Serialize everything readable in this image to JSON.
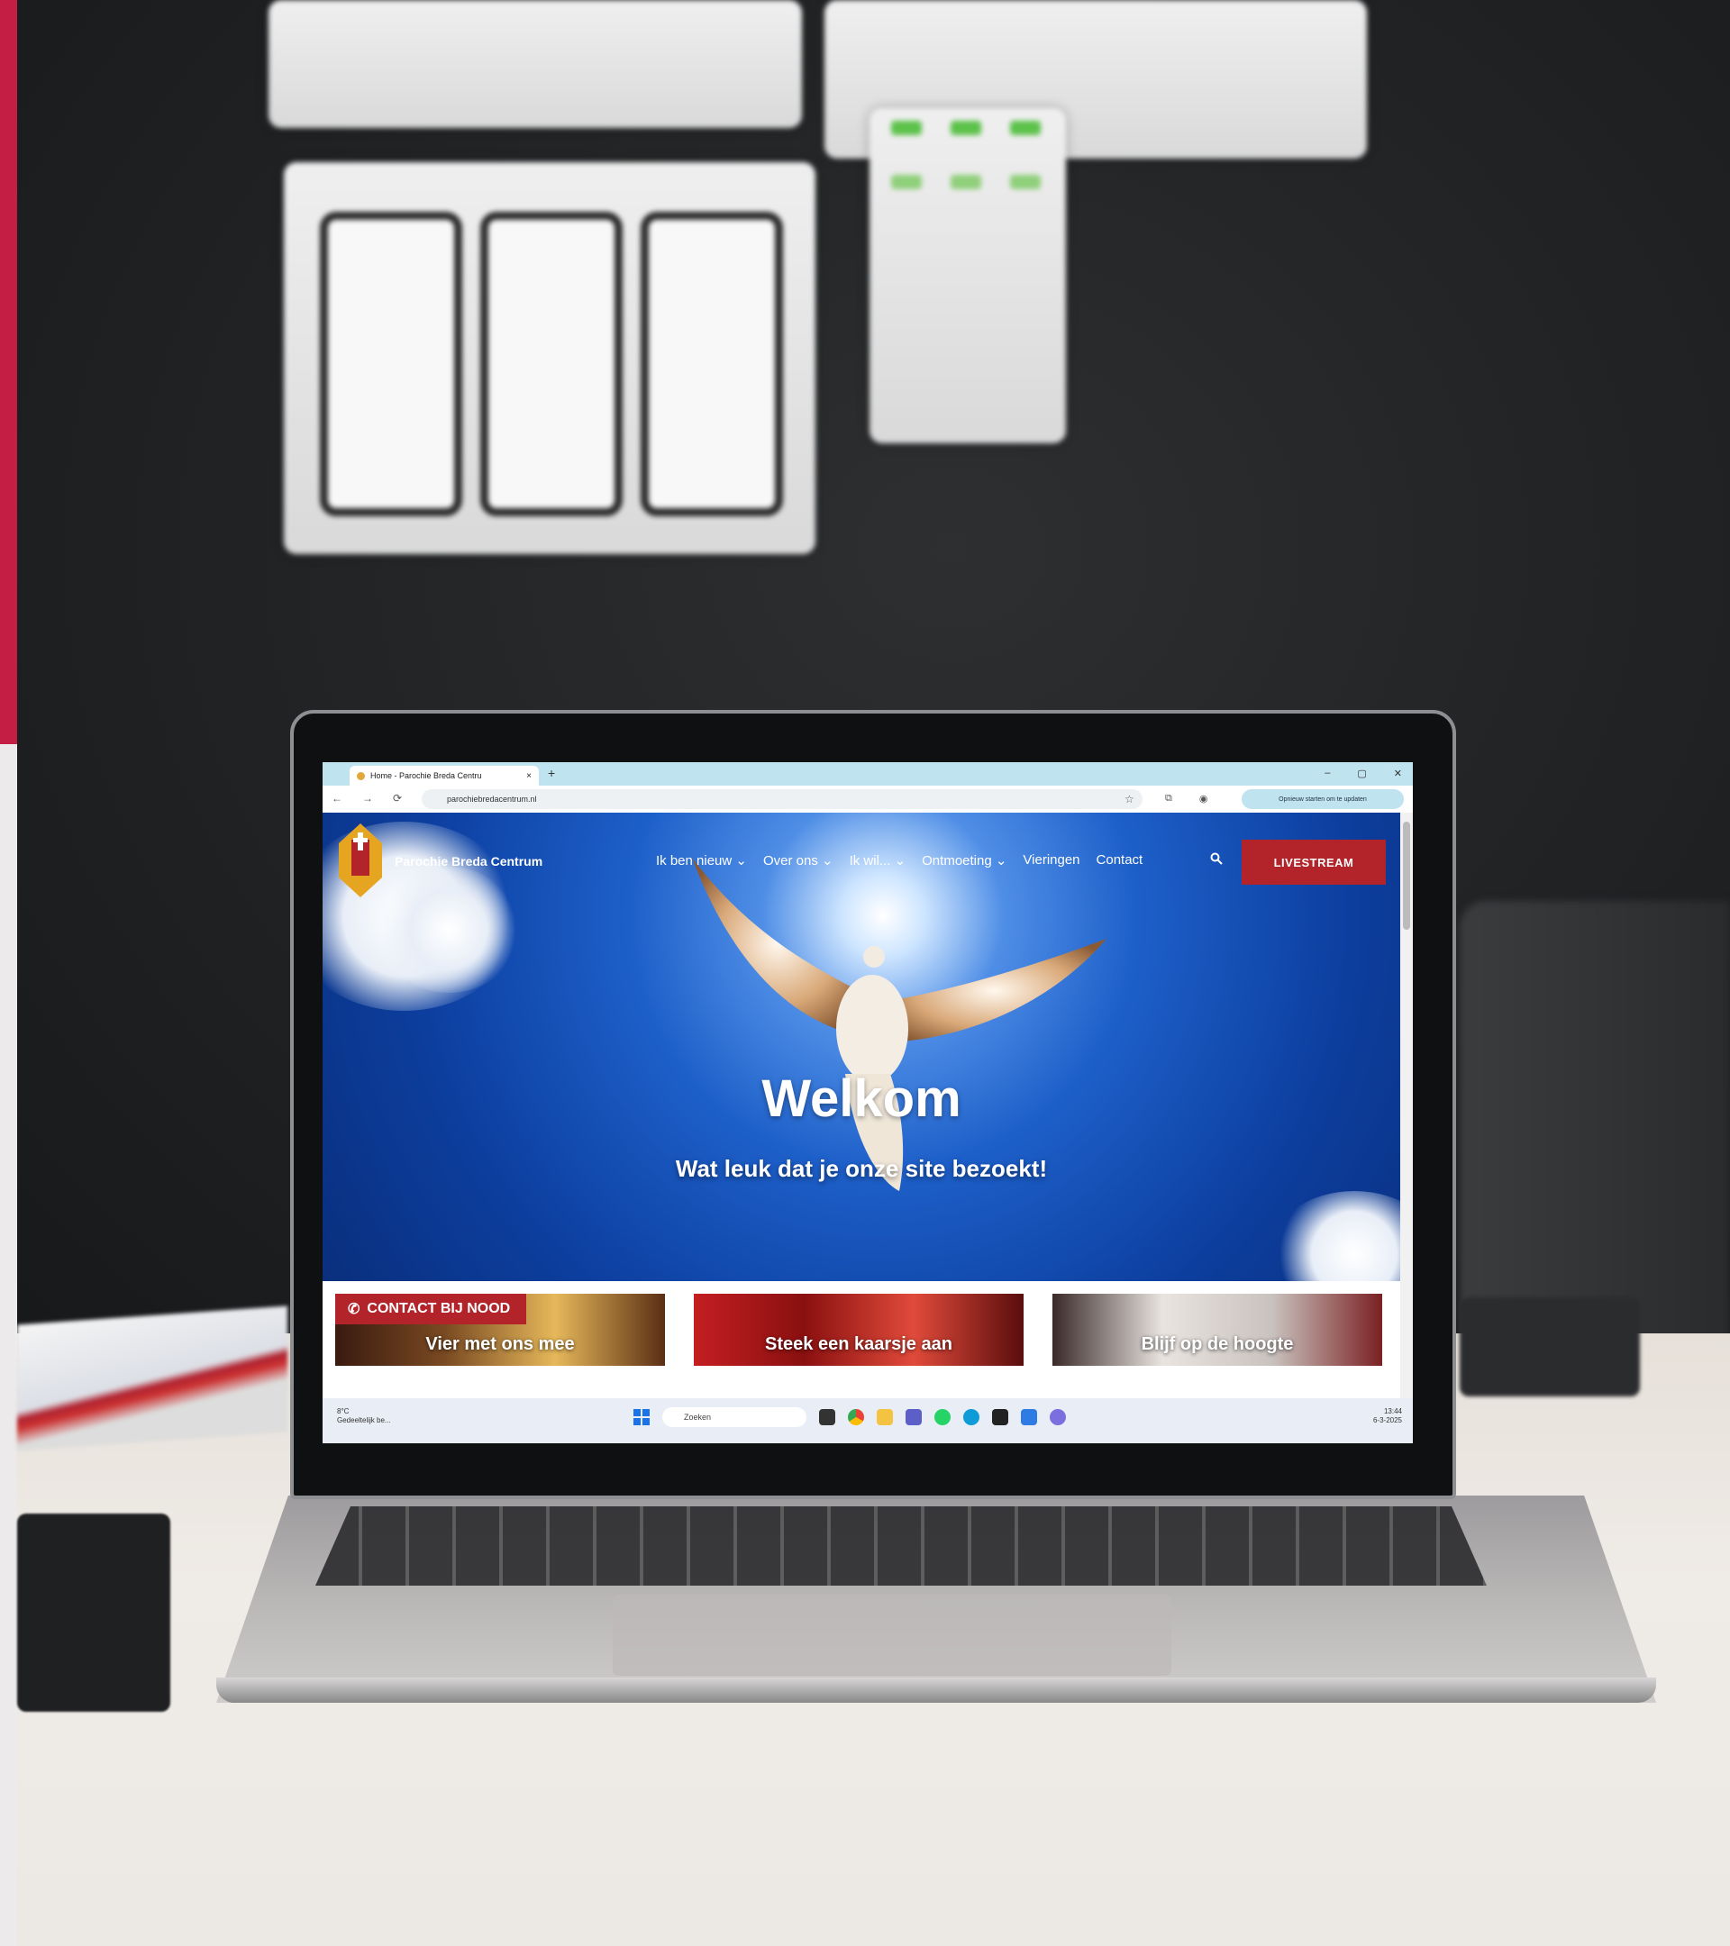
{
  "colors": {
    "brand_red": "#b3242a",
    "accent_bar": "#c41e45",
    "hero_blue": "#1d5fc9",
    "tab_bar": "#bfe3ef"
  },
  "browser": {
    "tab_title": "Home - Parochie Breda Centru",
    "tab_close": "×",
    "new_tab": "+",
    "window_controls": [
      "–",
      "▢",
      "✕"
    ],
    "nav_buttons": [
      "←",
      "→",
      "⟳"
    ],
    "url": "parochiebredacentrum.nl",
    "update_button": "Opnieuw starten om te updaten"
  },
  "site": {
    "name": "Parochie Breda Centrum",
    "nav": [
      "Ik ben nieuw ⌄",
      "Over ons ⌄",
      "Ik wil... ⌄",
      "Ontmoeting ⌄",
      "Vieringen",
      "Contact"
    ],
    "livestream_label": "LIVESTREAM",
    "hero_title": "Welkom",
    "hero_subtitle": "Wat leuk dat je onze site bezoekt!",
    "emergency_label": "CONTACT BIJ NOOD",
    "cards": [
      "Vier met ons mee",
      "Steek een kaarsje aan",
      "Blijf op de hoogte"
    ]
  },
  "taskbar": {
    "weather_temp": "8°C",
    "weather_text": "Gedeeltelijk be...",
    "search_placeholder": "Zoeken",
    "time": "13:44",
    "date": "6-3-2025",
    "icons": [
      "windows-icon",
      "search-icon",
      "file-explorer-icon",
      "chrome-icon",
      "folder-icon",
      "teams-icon",
      "whatsapp-icon",
      "edge-icon",
      "app-icon",
      "onedrive-icon",
      "chat-icon"
    ]
  }
}
